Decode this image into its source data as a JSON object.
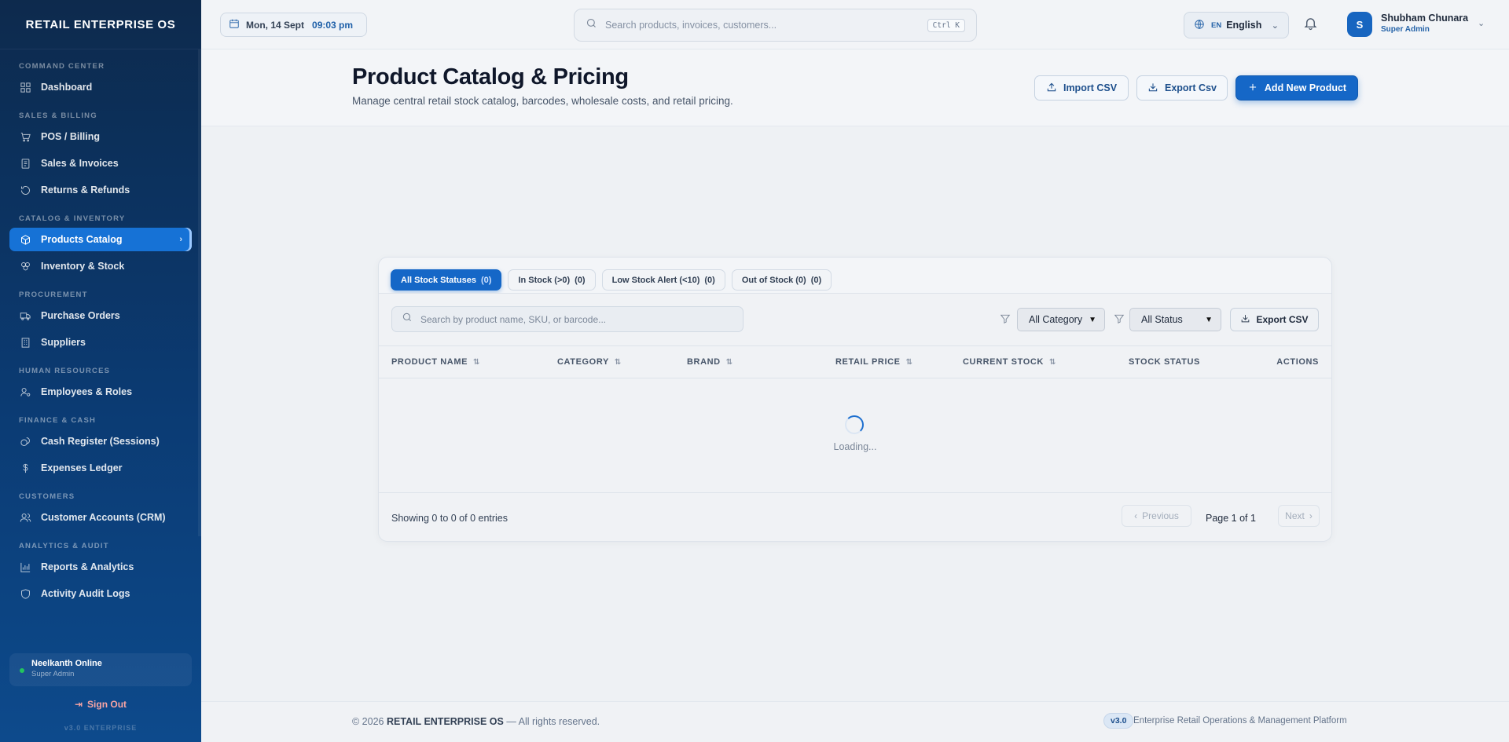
{
  "app": {
    "brand": "RETAIL ENTERPRISE OS"
  },
  "sidebar": {
    "sections": [
      {
        "title": "COMMAND CENTER",
        "items": [
          {
            "label": "Dashboard",
            "icon": "dashboard-icon"
          }
        ]
      },
      {
        "title": "SALES & BILLING",
        "items": [
          {
            "label": "POS / Billing",
            "icon": "cart-icon"
          },
          {
            "label": "Sales & Invoices",
            "icon": "invoice-icon"
          },
          {
            "label": "Returns & Refunds",
            "icon": "refund-icon"
          }
        ]
      },
      {
        "title": "CATALOG & INVENTORY",
        "items": [
          {
            "label": "Products Catalog",
            "icon": "box-icon",
            "active": true
          },
          {
            "label": "Inventory & Stock",
            "icon": "stock-icon"
          }
        ]
      },
      {
        "title": "PROCUREMENT",
        "items": [
          {
            "label": "Purchase Orders",
            "icon": "truck-icon"
          },
          {
            "label": "Suppliers",
            "icon": "building-icon"
          }
        ]
      },
      {
        "title": "HUMAN RESOURCES",
        "items": [
          {
            "label": "Employees & Roles",
            "icon": "user-cog-icon"
          }
        ]
      },
      {
        "title": "FINANCE & CASH",
        "items": [
          {
            "label": "Cash Register (Sessions)",
            "icon": "coins-icon"
          },
          {
            "label": "Expenses Ledger",
            "icon": "dollar-icon"
          }
        ]
      },
      {
        "title": "CUSTOMERS",
        "items": [
          {
            "label": "Customer Accounts (CRM)",
            "icon": "users-icon"
          }
        ]
      },
      {
        "title": "ANALYTICS & AUDIT",
        "items": [
          {
            "label": "Reports & Analytics",
            "icon": "chart-icon"
          },
          {
            "label": "Activity Audit Logs",
            "icon": "shield-icon"
          }
        ]
      }
    ],
    "user": {
      "name": "Neelkanth Online",
      "role": "Super Admin",
      "status_color": "#22c55e"
    },
    "sign_out": "Sign Out",
    "version": "v3.0 ENTERPRISE"
  },
  "topbar": {
    "date": "Mon, 14 Sept",
    "time": "09:03 pm",
    "search_placeholder": "Search products, invoices, customers...",
    "shortcut": "Ctrl K",
    "lang_code": "EN",
    "language": "English",
    "user_initial": "S",
    "user_name": "Shubham Chunara",
    "user_role": "Super Admin"
  },
  "header": {
    "title": "Product Catalog & Pricing",
    "subtitle": "Manage central retail stock catalog, barcodes, wholesale costs, and retail pricing.",
    "import_label": "Import CSV",
    "export_label": "Export Csv",
    "add_label": "Add New Product"
  },
  "tabs": [
    {
      "label": "All Stock Statuses",
      "count": "(0)",
      "active": true
    },
    {
      "label": "In Stock (>0)",
      "count": "(0)"
    },
    {
      "label": "Low Stock Alert (<10)",
      "count": "(0)"
    },
    {
      "label": "Out of Stock (0)",
      "count": "(0)"
    }
  ],
  "toolbar": {
    "search_placeholder": "Search by product name, SKU, or barcode...",
    "category_select": "All Category",
    "status_select": "All Status",
    "export_label": "Export CSV"
  },
  "table": {
    "columns": [
      "PRODUCT NAME",
      "CATEGORY",
      "BRAND",
      "RETAIL PRICE",
      "CURRENT STOCK",
      "STOCK STATUS",
      "ACTIONS"
    ],
    "loading_text": "Loading..."
  },
  "pagination": {
    "showing": "Showing 0 to 0 of 0 entries",
    "previous": "Previous",
    "page": "Page 1 of 1",
    "next": "Next"
  },
  "footer": {
    "copyright_prefix": "© 2026",
    "brand": "RETAIL ENTERPRISE OS",
    "copyright_suffix": "— All rights reserved.",
    "version": "v3.0",
    "platform": "Enterprise Retail Operations & Management Platform"
  },
  "colors": {
    "primary": "#1567c7",
    "sidebar": "#0b3b73",
    "danger_text": "#f8a4a4"
  }
}
